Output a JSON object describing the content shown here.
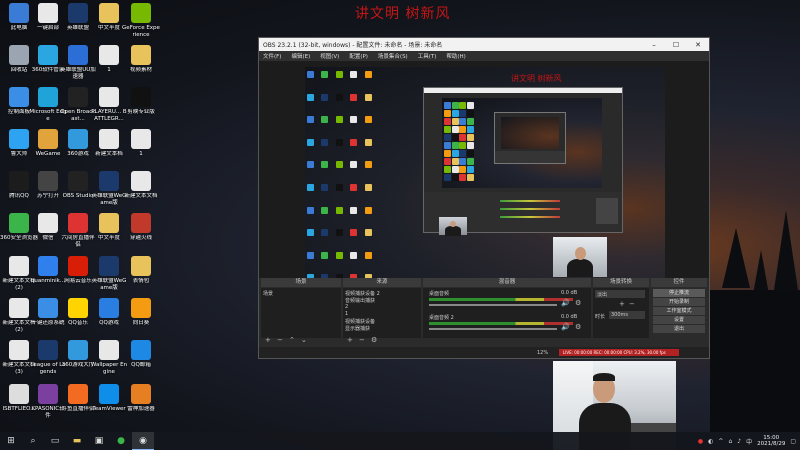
{
  "banner": {
    "title": "讲文明 树新风"
  },
  "desktop": {
    "icons": [
      {
        "label": "此电脑",
        "icon": "computer-icon",
        "color": "#3a7bd5"
      },
      {
        "label": "一键启部",
        "icon": "file-icon",
        "color": "#e8e8e8"
      },
      {
        "label": "英雄联盟",
        "icon": "lol-icon",
        "color": "#1b3a6b"
      },
      {
        "label": "中文半度",
        "icon": "folder-icon",
        "color": "#e8c25a"
      },
      {
        "label": "GeForce Experience",
        "icon": "nvidia-icon",
        "color": "#76b900"
      },
      {
        "label": "回收站",
        "icon": "recycle-bin-icon",
        "color": "#9aa5b1"
      },
      {
        "label": "360软件管家",
        "icon": "360-manager-icon",
        "color": "#2aa6e0"
      },
      {
        "label": "英雄联盟UU加速器",
        "icon": "uu-icon",
        "color": "#2b6fd6"
      },
      {
        "label": "1",
        "icon": "file-icon",
        "color": "#e8e8e8"
      },
      {
        "label": "视频素材",
        "icon": "folder-icon",
        "color": "#e8c25a"
      },
      {
        "label": "控制面板",
        "icon": "control-panel-icon",
        "color": "#3a8ee6"
      },
      {
        "label": "Microsoft Edge",
        "icon": "edge-icon",
        "color": "#1fa3d9"
      },
      {
        "label": "Open Broadcast...",
        "icon": "obs-icon",
        "color": "#222"
      },
      {
        "label": "PLAYERU... BATTLEGR...",
        "icon": "file-icon",
        "color": "#e8e8e8"
      },
      {
        "label": "剪映专业版",
        "icon": "capcut-icon",
        "color": "#111"
      },
      {
        "label": "鲁大师",
        "icon": "ludashi-icon",
        "color": "#2ea3f2"
      },
      {
        "label": "WeGame",
        "icon": "wegame-icon",
        "color": "#e1a43c"
      },
      {
        "label": "360游戏",
        "icon": "360-game-icon",
        "color": "#3399dd"
      },
      {
        "label": "新建文本档",
        "icon": "text-file-icon",
        "color": "#e8e8e8"
      },
      {
        "label": "1",
        "icon": "file-icon",
        "color": "#e8e8e8"
      },
      {
        "label": "腾讯QQ",
        "icon": "qq-icon",
        "color": "#1c1c1c"
      },
      {
        "label": "苏宁打开",
        "icon": "suning-icon",
        "color": "#444"
      },
      {
        "label": "OBS Studio",
        "icon": "obs-icon",
        "color": "#222"
      },
      {
        "label": "英雄联盟WeGame版",
        "icon": "lol-icon",
        "color": "#1b3a6b"
      },
      {
        "label": "新建文本文档",
        "icon": "text-file-icon",
        "color": "#e8e8e8"
      },
      {
        "label": "360安全浏览器",
        "icon": "360-browser-icon",
        "color": "#3bb54a"
      },
      {
        "label": "微信",
        "icon": "wechat-icon",
        "color": "#e8e8e8"
      },
      {
        "label": "六间房直播伴侣",
        "icon": "6rooms-icon",
        "color": "#d33"
      },
      {
        "label": "中文半度",
        "icon": "folder-icon",
        "color": "#e8c25a"
      },
      {
        "label": "穿越火线",
        "icon": "cf-icon",
        "color": "#c0392b"
      },
      {
        "label": "新建文本文档(2)",
        "icon": "text-file-icon",
        "color": "#e8e8e8"
      },
      {
        "label": "quanminik...",
        "icon": "app-icon",
        "color": "#2f80ed"
      },
      {
        "label": "网易云音乐",
        "icon": "netease-music-icon",
        "color": "#d81e06"
      },
      {
        "label": "英雄联盟WeGame版",
        "icon": "lol-icon",
        "color": "#1b3a6b"
      },
      {
        "label": "表情包",
        "icon": "folder-icon",
        "color": "#e8c25a"
      },
      {
        "label": "新建文本文档(2)",
        "icon": "text-file-icon",
        "color": "#e8e8e8"
      },
      {
        "label": "一键还原系统",
        "icon": "restore-icon",
        "color": "#3a8ee6"
      },
      {
        "label": "QQ音乐",
        "icon": "qq-music-icon",
        "color": "#ffd400"
      },
      {
        "label": "QQ游戏",
        "icon": "qq-game-icon",
        "color": "#2a7de1"
      },
      {
        "label": "向日葵",
        "icon": "sunflower-icon",
        "color": "#f39c12"
      },
      {
        "label": "新建文本文档(3)",
        "icon": "text-file-icon",
        "color": "#e8e8e8"
      },
      {
        "label": "League of Legends",
        "icon": "lol-icon",
        "color": "#1b3a6b"
      },
      {
        "label": "360游戏大厅",
        "icon": "360-hall-icon",
        "color": "#3399dd"
      },
      {
        "label": "Wallpaper Engine",
        "icon": "file-icon",
        "color": "#e8e8e8"
      },
      {
        "label": "QQ邮箱",
        "icon": "qq-mail-icon",
        "color": "#1e88e5"
      },
      {
        "label": "ISBTFLIEO...",
        "icon": "id-card-icon",
        "color": "#ddd"
      },
      {
        "label": "KPASONIC软件",
        "icon": "app-icon",
        "color": "#7b3fa0"
      },
      {
        "label": "斗鱼直播伴侣",
        "icon": "douyu-icon",
        "color": "#f26b21"
      },
      {
        "label": "TeamViewer",
        "icon": "teamviewer-icon",
        "color": "#0e8ee9"
      },
      {
        "label": "雷神加速器",
        "icon": "leishen-icon",
        "color": "#e67e22"
      }
    ]
  },
  "obs": {
    "title": "OBS 23.2.1 (32-bit, windows) - 配置文件: 未命名 - 场景: 未命名",
    "window_controls": [
      "–",
      "☐",
      "✕"
    ],
    "menu": [
      "文件(F)",
      "编辑(E)",
      "视图(V)",
      "配置(P)",
      "场景集合(S)",
      "工具(T)",
      "帮助(H)"
    ],
    "preview_title": "讲文明 树新风",
    "docks": {
      "scenes": {
        "header": "场景",
        "items": [
          "场景"
        ]
      },
      "sources": {
        "header": "来源",
        "items": [
          "视频捕获设备 2",
          "音频输出捕获",
          "2",
          "1",
          "视频捕获设备",
          "显示器捕获"
        ]
      },
      "mixer": {
        "header": "混音器",
        "channels": [
          {
            "name": "桌面音频",
            "db": "0.0 dB"
          },
          {
            "name": "桌面音频 2",
            "db": "0.0 dB"
          }
        ]
      },
      "transitions": {
        "header": "场景转换",
        "type": "淡出",
        "duration_label": "时长",
        "duration": "300ms"
      },
      "controls": {
        "header": "控件",
        "buttons": [
          "停止推流",
          "开始录制",
          "工作室模式",
          "设置",
          "退出"
        ]
      }
    },
    "status": "LIVE: 00:00:00  REC: 00:00:00  CPU: 3.2%, 30.00 fps",
    "status_short": "12%"
  },
  "taskbar": {
    "items": [
      {
        "icon": "windows-start-icon",
        "glyph": "⊞"
      },
      {
        "icon": "search-icon",
        "glyph": "⌕"
      },
      {
        "icon": "task-view-icon",
        "glyph": "▭"
      },
      {
        "icon": "file-explorer-icon",
        "glyph": "▬"
      },
      {
        "icon": "store-icon",
        "glyph": "▣"
      },
      {
        "icon": "browser-icon",
        "glyph": "●"
      },
      {
        "icon": "obs-taskbar-icon",
        "glyph": "◉"
      }
    ],
    "clock_time": "15:00",
    "clock_date": "2021/8/29"
  }
}
